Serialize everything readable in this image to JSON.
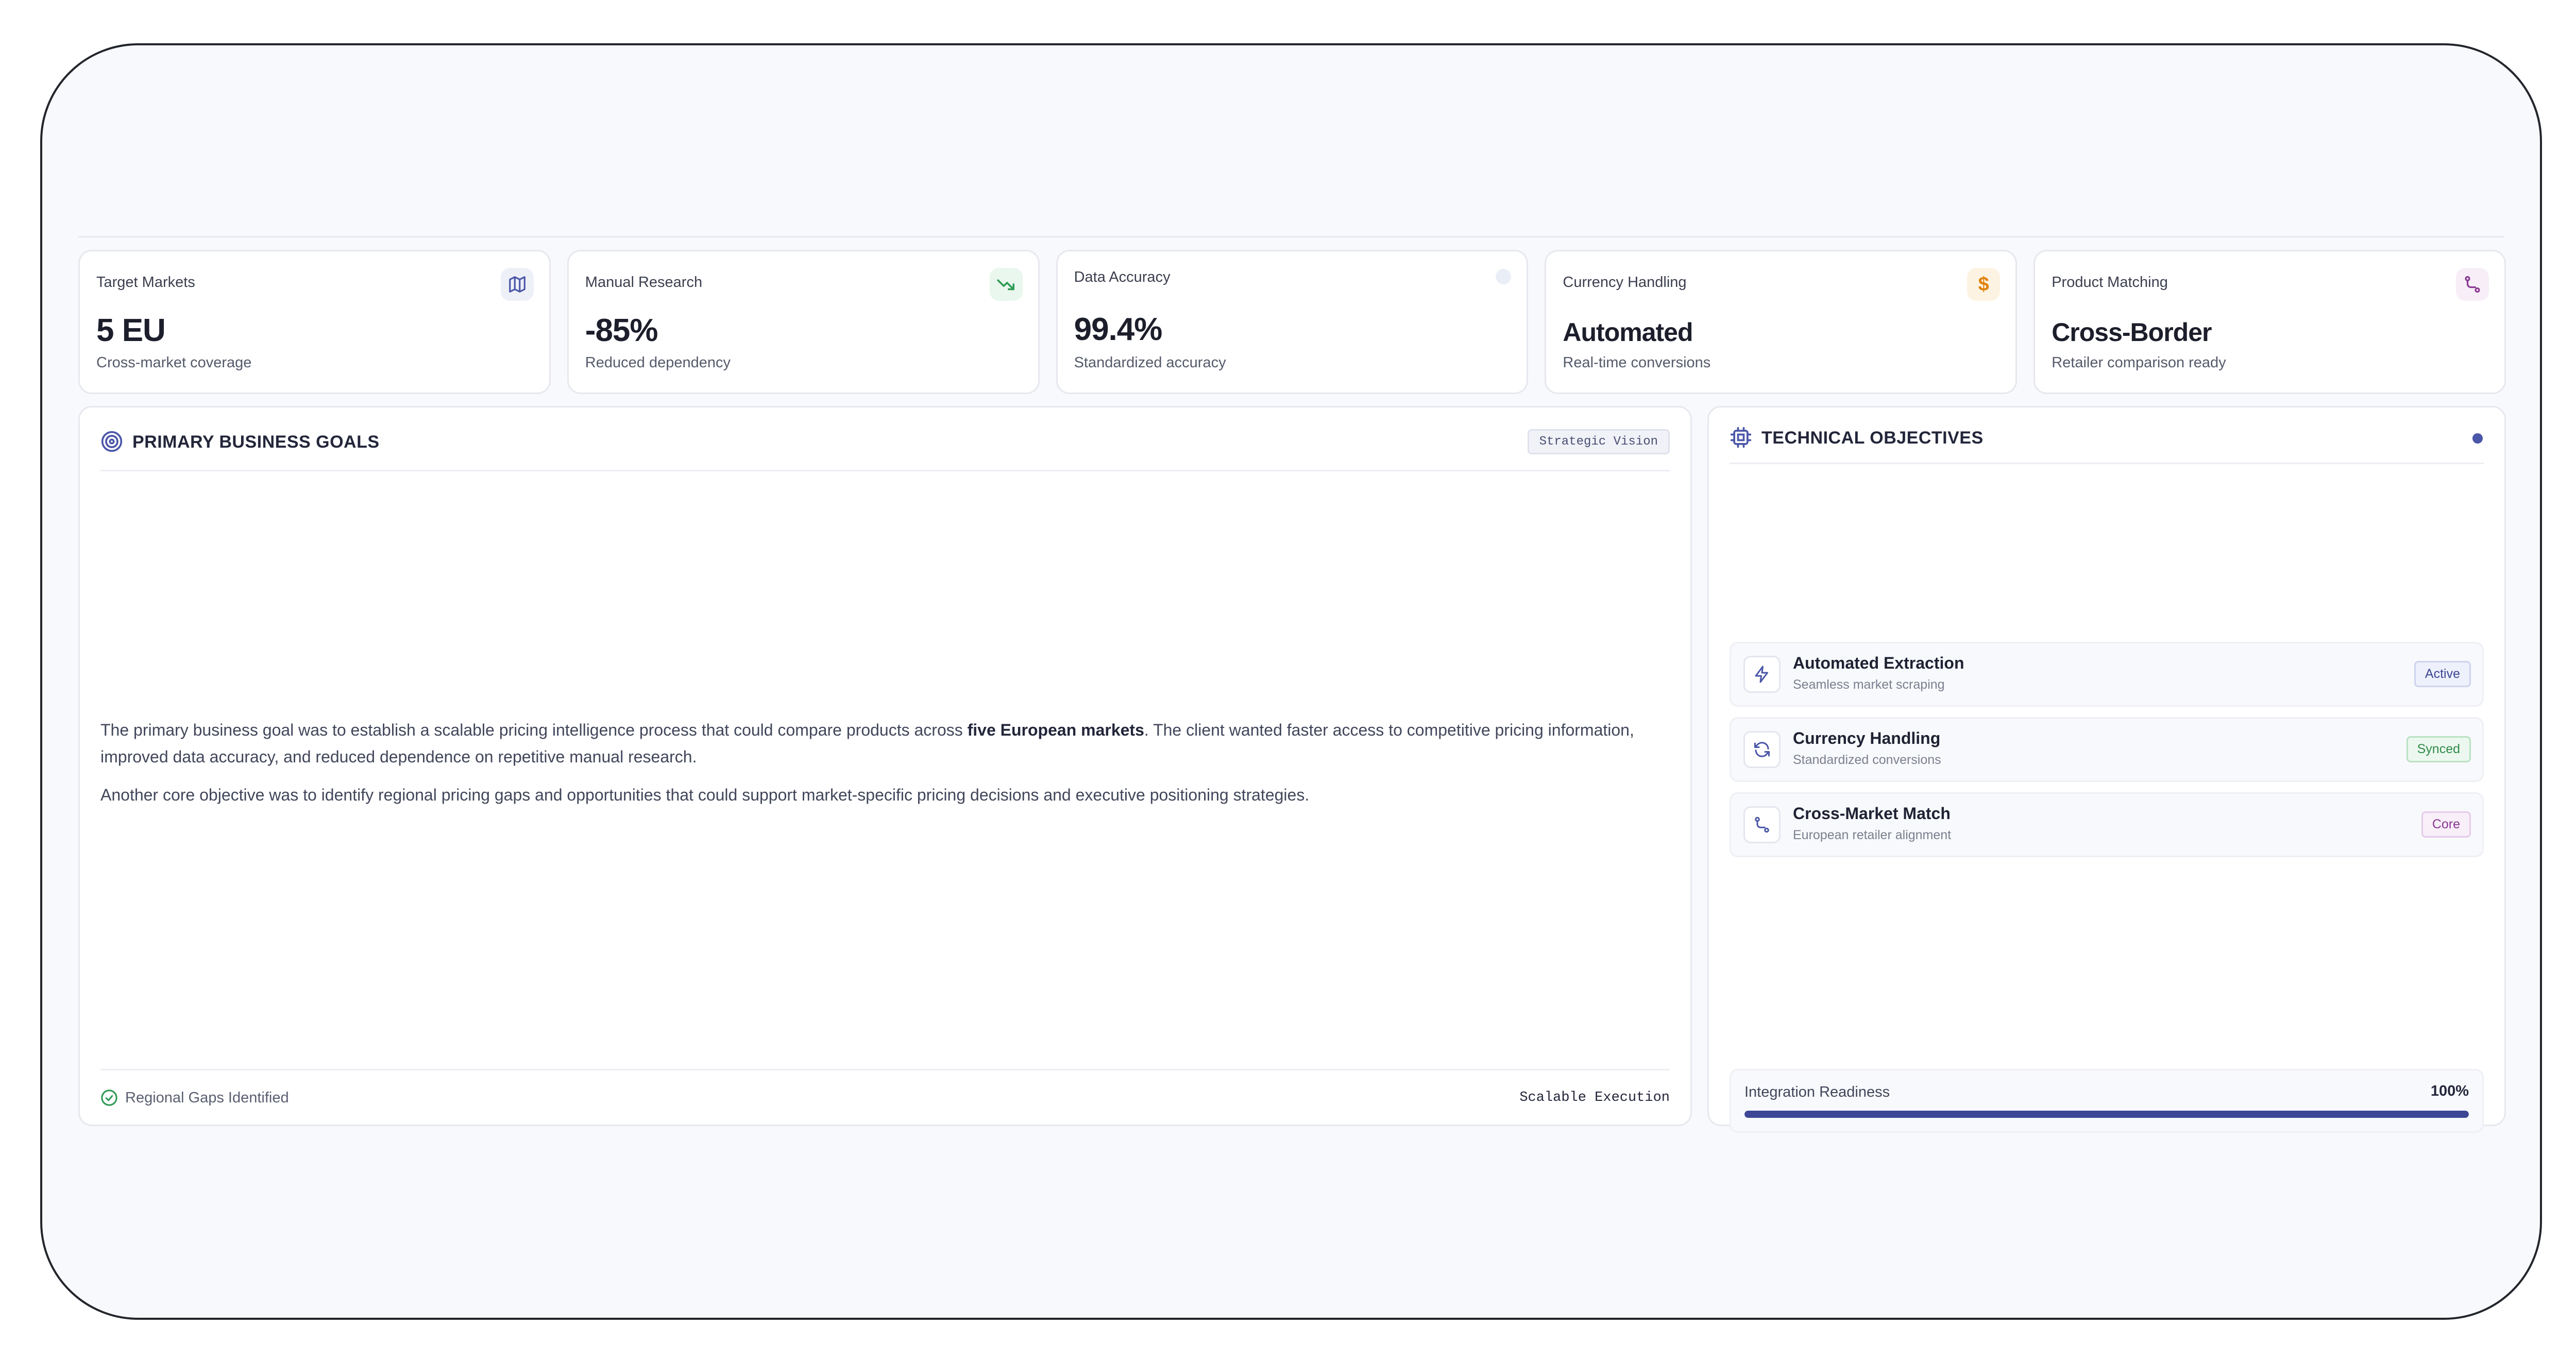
{
  "metrics": [
    {
      "label": "Target Markets",
      "value": "5 EU",
      "sub": "Cross-market coverage",
      "icon": "map-icon",
      "accent": "#4a56a8"
    },
    {
      "label": "Manual Research",
      "value": "-85%",
      "sub": "Reduced dependency",
      "icon": "trending-down-icon",
      "accent": "#2f9a55"
    },
    {
      "label": "Data Accuracy",
      "value": "99.4%",
      "sub": "Standardized accuracy",
      "icon": "status-dot-icon",
      "accent": "#e3e8f4"
    },
    {
      "label": "Currency Handling",
      "value": "Automated",
      "sub": "Real-time conversions",
      "icon": "dollar-icon",
      "accent": "#e0820c"
    },
    {
      "label": "Product Matching",
      "value": "Cross-Border",
      "sub": "Retailer comparison ready",
      "icon": "route-icon",
      "accent": "#8a3693"
    }
  ],
  "goals": {
    "title": "PRIMARY BUSINESS GOALS",
    "badge": "Strategic Vision",
    "para1_before": "The primary business goal was to establish a scalable pricing intelligence process that could compare products across ",
    "para1_bold": "five European markets",
    "para1_after": ". The client wanted faster access to competitive pricing information, improved data accuracy, and reduced dependence on repetitive manual research.",
    "para2": "Another core objective was to identify regional pricing gaps and opportunities that could support market-specific pricing decisions and executive positioning strategies.",
    "footer_left": "Regional Gaps Identified",
    "footer_right": "Scalable Execution"
  },
  "technical": {
    "title": "TECHNICAL OBJECTIVES",
    "items": [
      {
        "title": "Automated Extraction",
        "sub": "Seamless market scraping",
        "badge": "Active",
        "icon": "zap-icon"
      },
      {
        "title": "Currency Handling",
        "sub": "Standardized conversions",
        "badge": "Synced",
        "icon": "refresh-icon"
      },
      {
        "title": "Cross-Market Match",
        "sub": "European retailer alignment",
        "badge": "Core",
        "icon": "route-icon"
      }
    ],
    "readiness_label": "Integration Readiness",
    "readiness_value": "100%",
    "readiness_fraction": 1.0
  }
}
